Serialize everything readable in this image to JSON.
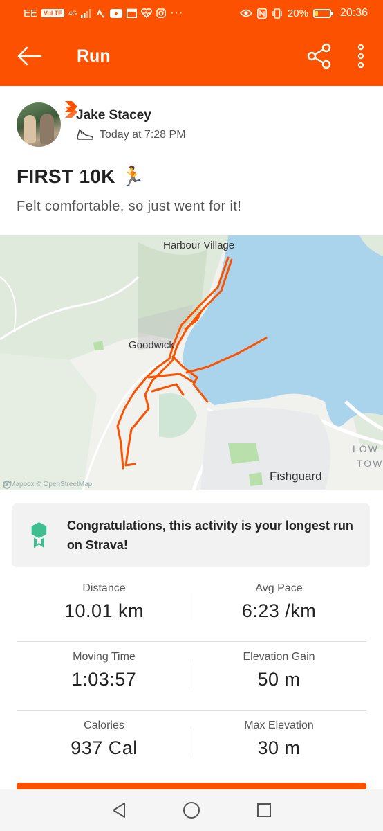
{
  "status_bar": {
    "carrier": "EE",
    "volte": "VoLTE",
    "network": "4G",
    "battery_percent": "20%",
    "battery_level": 0.2,
    "time": "20:36"
  },
  "app_bar": {
    "title": "Run"
  },
  "activity": {
    "athlete_name": "Jake Stacey",
    "timestamp": "Today at 7:28 PM",
    "title": "FIRST 10K 🏃",
    "description": "Felt comfortable, so just went for it!"
  },
  "map": {
    "labels": {
      "harbour_village": "Harbour Village",
      "goodwick": "Goodwick",
      "fishguard": "Fishguard",
      "lower_town_1": "LOW",
      "lower_town_2": "TOW"
    },
    "attribution": "© Mapbox © OpenStreetMap",
    "route_color": "#fc5200",
    "water_color": "#a9d4ec"
  },
  "achievement": {
    "text": "Congratulations, this activity is your longest run on Strava!",
    "icon": "achievement-ribbon-icon",
    "color": "#3fbf8f"
  },
  "stats": [
    {
      "left": {
        "label": "Distance",
        "value": "10.01 km"
      },
      "right": {
        "label": "Avg Pace",
        "value": "6:23 /km"
      }
    },
    {
      "left": {
        "label": "Moving Time",
        "value": "1:03:57"
      },
      "right": {
        "label": "Elevation Gain",
        "value": "50 m"
      }
    },
    {
      "left": {
        "label": "Calories",
        "value": "937 Cal"
      },
      "right": {
        "label": "Max Elevation",
        "value": "30 m"
      }
    }
  ],
  "colors": {
    "brand": "#fc5200",
    "text_primary": "#222222",
    "text_secondary": "#555555"
  }
}
